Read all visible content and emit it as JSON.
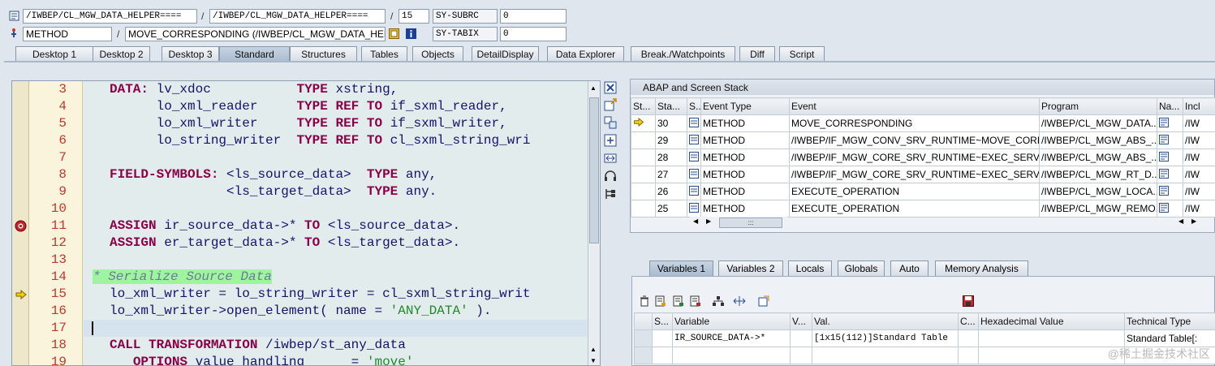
{
  "header": {
    "row1": {
      "program": "/IWBEP/CL_MGW_DATA_HELPER====",
      "include": "/IWBEP/CL_MGW_DATA_HELPER====",
      "line": "15",
      "var_name": "SY-SUBRC",
      "var_value": "0",
      "sep": "/"
    },
    "row2": {
      "event_type": "METHOD",
      "event": "MOVE_CORRESPONDING (/IWBEP/CL_MGW_DATA_HEL...",
      "var_name": "SY-TABIX",
      "var_value": "0",
      "sep": "/"
    }
  },
  "tabs": [
    "Desktop 1",
    "Desktop 2",
    "Desktop 3",
    "Standard",
    "Structures",
    "Tables",
    "Objects",
    "DetailDisplay",
    "Data Explorer",
    "Break./Watchpoints",
    "Diff",
    "Script"
  ],
  "active_tab": "Standard",
  "editor": {
    "line_numbers": [
      "3",
      "4",
      "5",
      "6",
      "7",
      "8",
      "9",
      "10",
      "11",
      "12",
      "13",
      "14",
      "15",
      "16",
      "17",
      "18",
      "19"
    ],
    "current_line": "15",
    "breakpoint_line": "11"
  },
  "stack": {
    "title": "ABAP and Screen Stack",
    "columns": [
      "St...",
      "Sta...",
      "S...",
      "Event Type",
      "Event",
      "Program",
      "Na...",
      "Incl"
    ],
    "rows": [
      {
        "level": "30",
        "type": "METHOD",
        "event": "MOVE_CORRESPONDING",
        "program": "/IWBEP/CL_MGW_DATA...",
        "incl": "/IW",
        "current": true
      },
      {
        "level": "29",
        "type": "METHOD",
        "event": "/IWBEP/IF_MGW_CONV_SRV_RUNTIME~MOVE_CORR...",
        "program": "/IWBEP/CL_MGW_ABS_...",
        "incl": "/IW",
        "current": false
      },
      {
        "level": "28",
        "type": "METHOD",
        "event": "/IWBEP/IF_MGW_CORE_SRV_RUNTIME~EXEC_SERVI...",
        "program": "/IWBEP/CL_MGW_ABS_...",
        "incl": "/IW",
        "current": false
      },
      {
        "level": "27",
        "type": "METHOD",
        "event": "/IWBEP/IF_MGW_CORE_SRV_RUNTIME~EXEC_SERVI...",
        "program": "/IWBEP/CL_MGW_RT_D...",
        "incl": "/IW",
        "current": false
      },
      {
        "level": "26",
        "type": "METHOD",
        "event": "EXECUTE_OPERATION",
        "program": "/IWBEP/CL_MGW_LOCA...",
        "incl": "/IW",
        "current": false
      },
      {
        "level": "25",
        "type": "METHOD",
        "event": "EXECUTE_OPERATION",
        "program": "/IWBEP/CL_MGW_REMO...",
        "incl": "/IW",
        "current": false
      }
    ],
    "hscroll_grip": ":::"
  },
  "var_tabs": [
    "Variables 1",
    "Variables 2",
    "Locals",
    "Globals",
    "Auto",
    "Memory Analysis"
  ],
  "active_var_tab": "Variables 1",
  "variables": {
    "columns": [
      "S...",
      "Variable",
      "V...",
      "Val.",
      "C...",
      "Hexadecimal Value",
      "Technical Type"
    ],
    "rows": [
      {
        "variable": "IR_SOURCE_DATA->*",
        "value": "[1x15(112)]Standard Table",
        "tech": "Standard Table[:"
      }
    ]
  },
  "watermark": "@稀土掘金技术社区",
  "colors": {
    "keyword": "#8b0047",
    "identifier": "#13136b",
    "string": "#1f8a2b",
    "comment_bg": "#9ff59f",
    "line_no": "#c0392b"
  }
}
